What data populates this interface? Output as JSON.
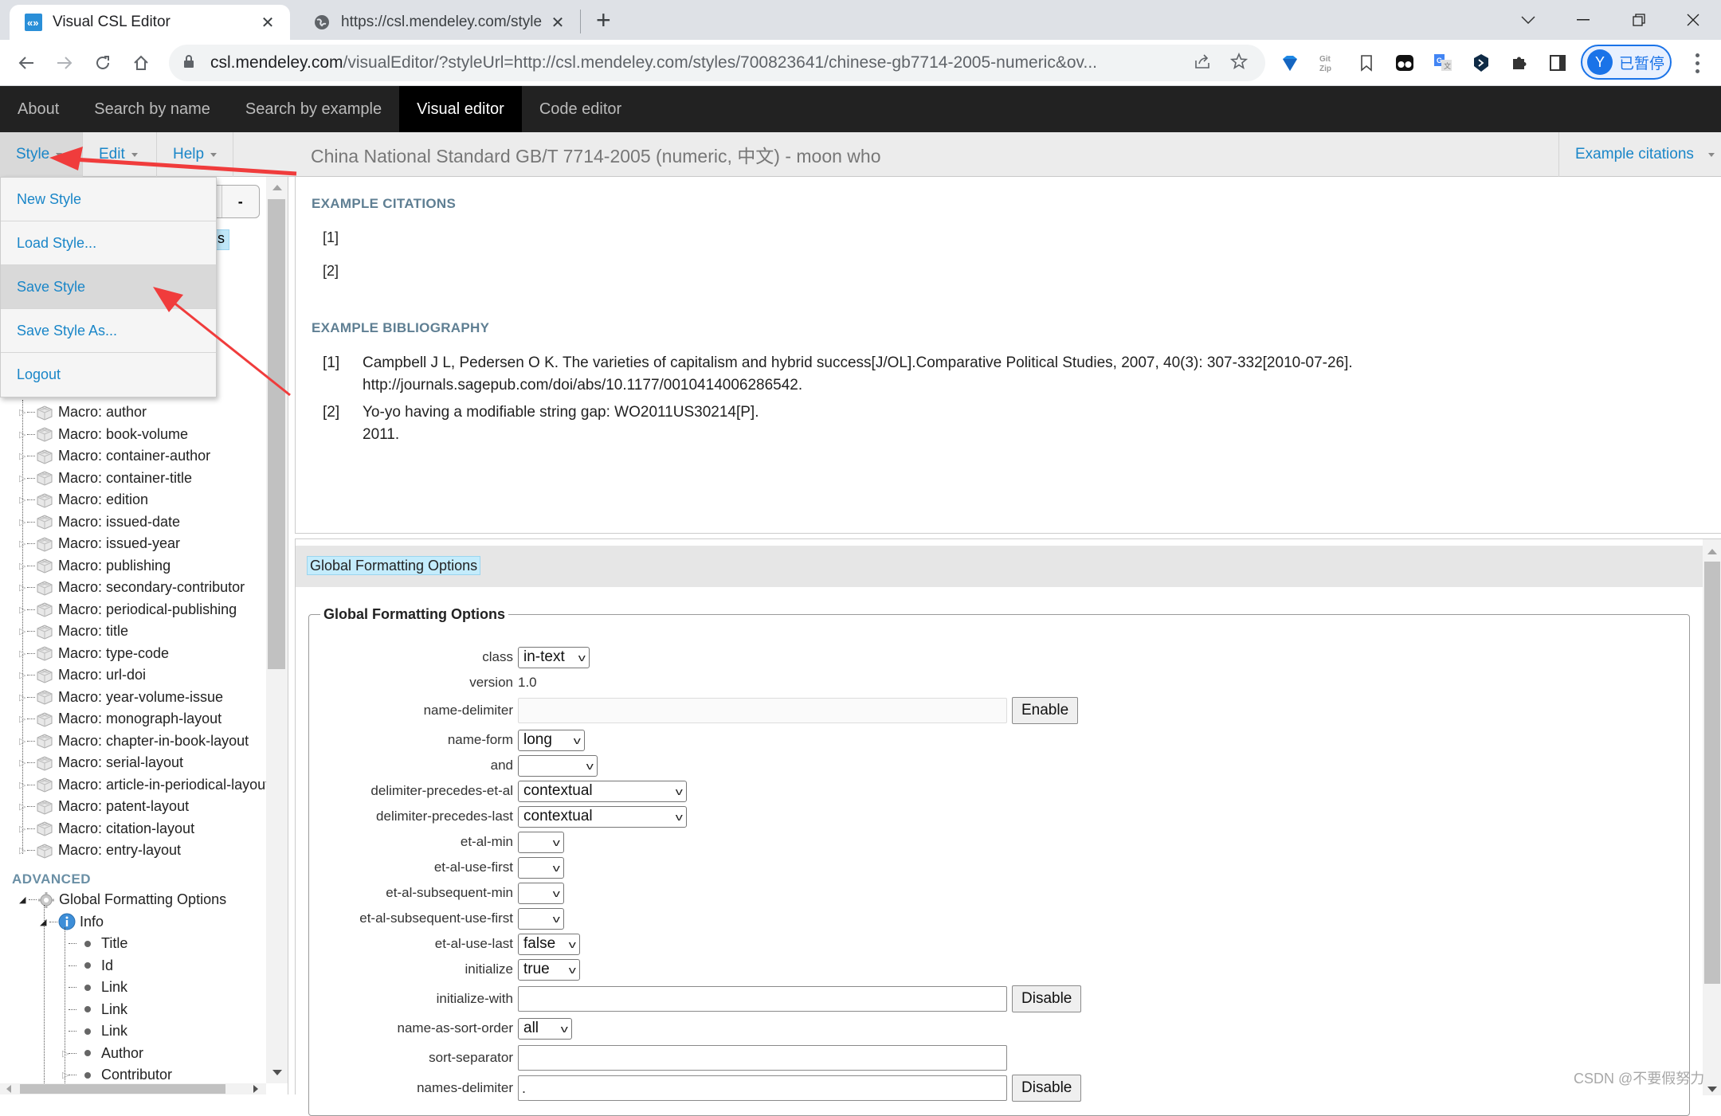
{
  "browser": {
    "tabs": [
      {
        "title": "Visual CSL Editor",
        "active": true,
        "icon": "csl-logo-icon"
      },
      {
        "title": "https://csl.mendeley.com/style",
        "active": false,
        "icon": "globe-icon"
      }
    ],
    "url_host": "csl.mendeley.com",
    "url_path": "/visualEditor/?styleUrl=http://csl.mendeley.com/styles/700823641/chinese-gb7714-2005-numeric&ov...",
    "profile_initial": "Y",
    "profile_status": "已暂停"
  },
  "appnav": {
    "items": [
      {
        "label": "About",
        "active": false
      },
      {
        "label": "Search by name",
        "active": false
      },
      {
        "label": "Search by example",
        "active": false
      },
      {
        "label": "Visual editor",
        "active": true
      },
      {
        "label": "Code editor",
        "active": false
      }
    ]
  },
  "toolbar": {
    "menus": [
      {
        "label": "Style",
        "open": true
      },
      {
        "label": "Edit",
        "open": false
      },
      {
        "label": "Help",
        "open": false
      }
    ],
    "style_title": "China National Standard GB/T 7714-2005 (numeric, 中文) - moon who",
    "example_citations_label": "Example citations"
  },
  "style_menu": {
    "items": [
      {
        "label": "New Style",
        "highlighted": false
      },
      {
        "label": "Load Style...",
        "highlighted": false
      },
      {
        "label": "Save Style",
        "highlighted": true
      },
      {
        "label": "Save Style As...",
        "highlighted": false
      },
      {
        "label": "Logout",
        "highlighted": false
      }
    ]
  },
  "tree": {
    "buttons": [
      "+",
      "-"
    ],
    "selected_fragment": "ns",
    "macros": [
      "Macro: author",
      "Macro: book-volume",
      "Macro: container-author",
      "Macro: container-title",
      "Macro: edition",
      "Macro: issued-date",
      "Macro: issued-year",
      "Macro: publishing",
      "Macro: secondary-contributor",
      "Macro: periodical-publishing",
      "Macro: title",
      "Macro: type-code",
      "Macro: url-doi",
      "Macro: year-volume-issue",
      "Macro: monograph-layout",
      "Macro: chapter-in-book-layout",
      "Macro: serial-layout",
      "Macro: article-in-periodical-layout",
      "Macro: patent-layout",
      "Macro: citation-layout",
      "Macro: entry-layout"
    ],
    "advanced_heading": "ADVANCED",
    "global_node": "Global Formatting Options",
    "info_node": "Info",
    "info_children": [
      "Title",
      "Id",
      "Link",
      "Link",
      "Link",
      "Author",
      "Contributor"
    ]
  },
  "examples": {
    "citations_heading": "EXAMPLE CITATIONS",
    "citations": [
      "[1]",
      "[2]"
    ],
    "bibliography_heading": "EXAMPLE BIBLIOGRAPHY",
    "bibliography": [
      {
        "num": "[1]",
        "line1": "Campbell J L, Pedersen O K. The varieties of capitalism and hybrid success[J/OL].Comparative Political Studies, 2007, 40(3): 307-332[2010-07-26].",
        "line2": "http://journals.sagepub.com/doi/abs/10.1177/0010414006286542."
      },
      {
        "num": "[2]",
        "line1": "Yo-yo having a modifiable string gap: WO2011US30214[P].",
        "line2": "2011."
      }
    ]
  },
  "properties": {
    "breadcrumb": "Global Formatting Options",
    "fieldset_legend": "Global Formatting Options",
    "fields": {
      "class": {
        "label": "class",
        "value": "in-text"
      },
      "version": {
        "label": "version",
        "value": "1.0"
      },
      "name_delimiter": {
        "label": "name-delimiter",
        "value": "",
        "button": "Enable"
      },
      "name_form": {
        "label": "name-form",
        "value": "long"
      },
      "and": {
        "label": "and",
        "value": ""
      },
      "delimiter_precedes_et_al": {
        "label": "delimiter-precedes-et-al",
        "value": "contextual"
      },
      "delimiter_precedes_last": {
        "label": "delimiter-precedes-last",
        "value": "contextual"
      },
      "et_al_min": {
        "label": "et-al-min",
        "value": ""
      },
      "et_al_use_first": {
        "label": "et-al-use-first",
        "value": ""
      },
      "et_al_subsequent_min": {
        "label": "et-al-subsequent-min",
        "value": ""
      },
      "et_al_subsequent_use_first": {
        "label": "et-al-subsequent-use-first",
        "value": ""
      },
      "et_al_use_last": {
        "label": "et-al-use-last",
        "value": "false"
      },
      "initialize": {
        "label": "initialize",
        "value": "true"
      },
      "initialize_with": {
        "label": "initialize-with",
        "value": "",
        "button": "Disable"
      },
      "name_as_sort_order": {
        "label": "name-as-sort-order",
        "value": "all"
      },
      "sort_separator": {
        "label": "sort-separator",
        "value": ""
      },
      "names_delimiter": {
        "label": "names-delimiter",
        "value": ".",
        "button": "Disable"
      }
    }
  },
  "watermark": "CSDN @不要假努力",
  "colors": {
    "link_blue": "#1a86c8",
    "annotation_red": "#f03c3c",
    "nav_dark": "#222222",
    "selection_blue": "#c4ecfc"
  }
}
